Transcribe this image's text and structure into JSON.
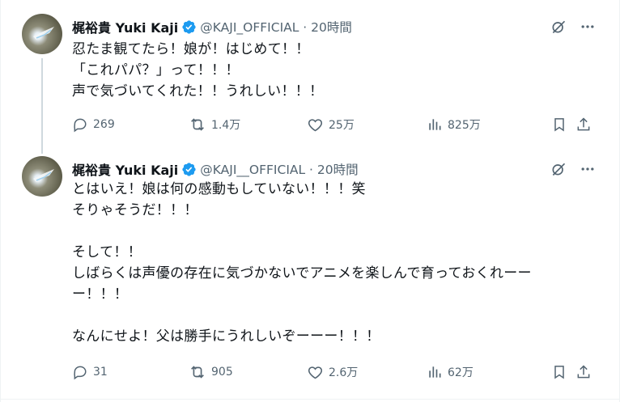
{
  "tweets": [
    {
      "name": "梶裕貴 Yuki Kaji",
      "handle_time": "@KAJI_OFFICIAL · 20時間",
      "text": "忍たま観てたら！娘が！はじめて！！\n「これパパ？」って！！！\n声で気づいてくれた！！うれしい！！！",
      "stats": {
        "replies": "269",
        "retweets": "1.4万",
        "likes": "25万",
        "views": "825万"
      }
    },
    {
      "name": "梶裕貴 Yuki Kaji",
      "handle_time": "@KAJI__OFFICIAL · 20時間",
      "text": "とはいえ！娘は何の感動もしていない！！！笑\nそりゃそうだ！！！\n\nそして！！\nしばらくは声優の存在に気づかないでアニメを楽しんで育っておくれーー\nー！！！\n\nなんにせよ！父は勝手にうれしいぞーーー！！！",
      "stats": {
        "replies": "31",
        "retweets": "905",
        "likes": "2.6万",
        "views": "62万"
      }
    }
  ],
  "icons": [
    "verified-badge-icon",
    "grok-icon",
    "more-icon",
    "reply-icon",
    "retweet-icon",
    "like-icon",
    "views-icon",
    "bookmark-icon",
    "share-icon"
  ],
  "colors": {
    "verified": "#1d9bf0",
    "icon_gray": "#536471",
    "text": "#0f1419"
  }
}
